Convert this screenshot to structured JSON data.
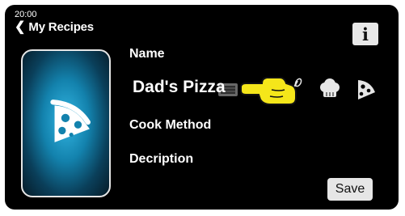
{
  "status": {
    "time": "20:00"
  },
  "header": {
    "back_label": "My Recipes",
    "back_icon": "chevron-left-icon",
    "info_label": "i"
  },
  "form": {
    "name_label": "Name",
    "name_value": "Dad's Pizza",
    "cook_method_label": "Cook Method",
    "description_label": "Decription"
  },
  "recipe_icons": [
    "grill-icon",
    "rocket-icon",
    "whisk-icon",
    "chef-hat-icon",
    "pizza-slice-icon"
  ],
  "buttons": {
    "save_label": "Save"
  },
  "colors": {
    "background": "#000000",
    "card_glow": "#1e9fd6",
    "hand_fill": "#f5e61a",
    "button_bg": "#e6e6e6"
  }
}
